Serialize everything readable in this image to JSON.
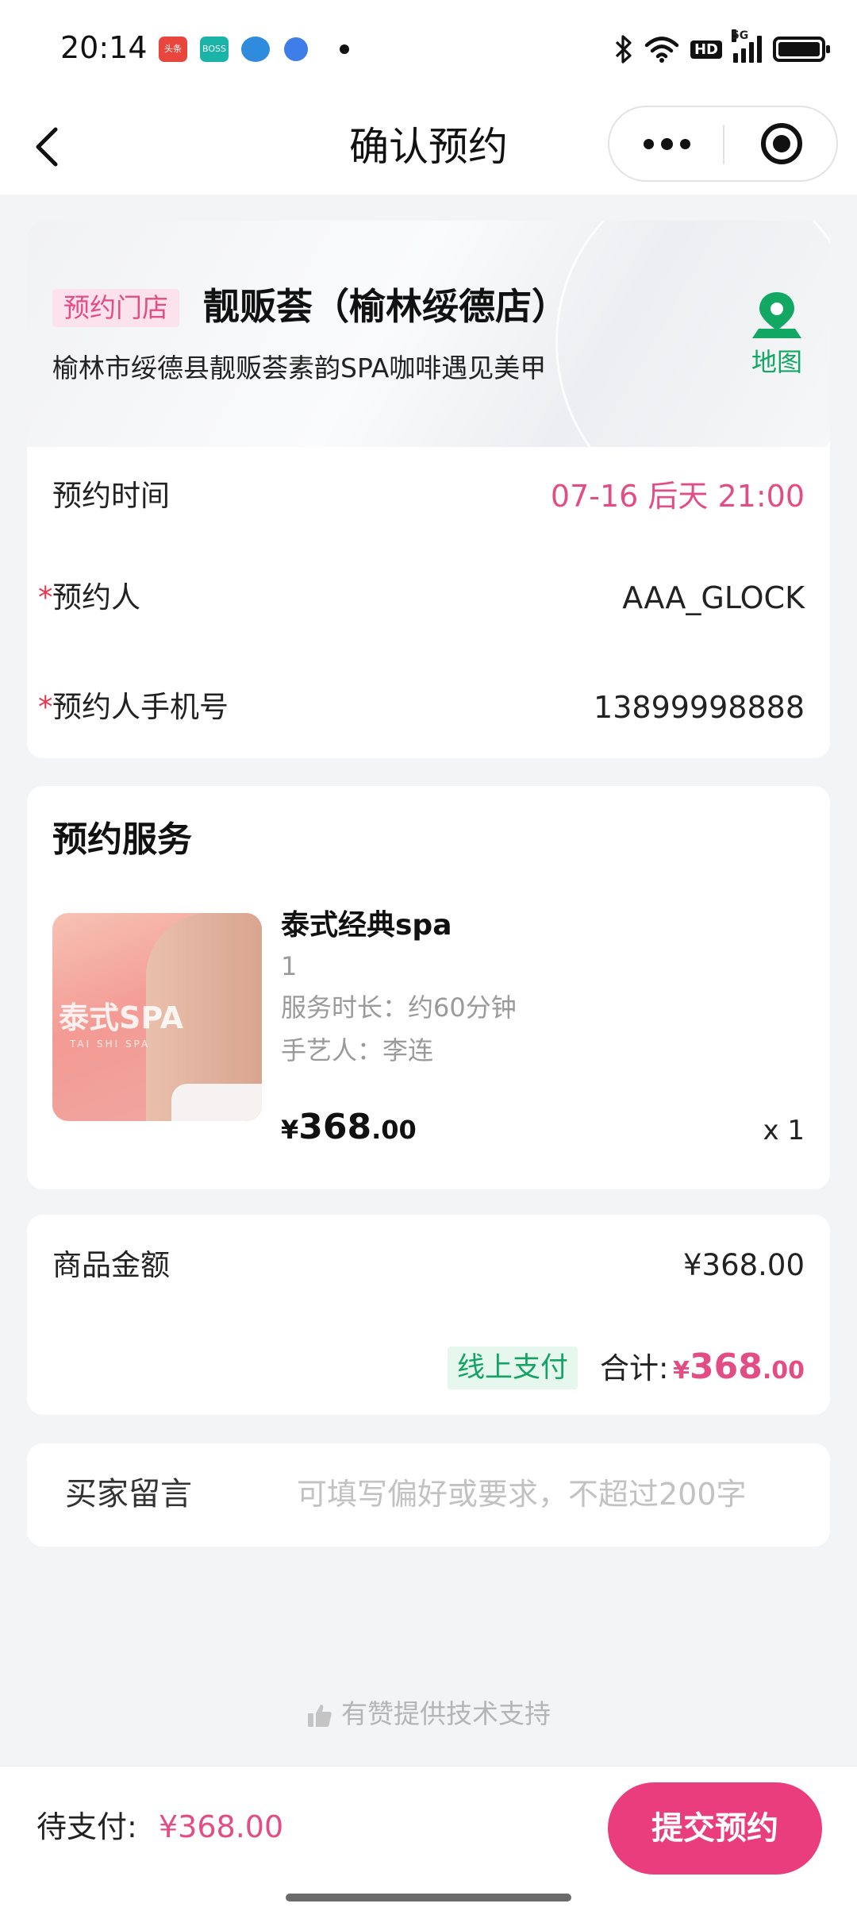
{
  "status_bar": {
    "time": "20:14",
    "apps": [
      "头条",
      "BOSS直聘",
      "",
      ""
    ],
    "hd": "HD",
    "signal": "5G"
  },
  "nav": {
    "title": "确认预约",
    "back_icon": "chevron-left-icon",
    "more_icon": "more-dots-icon",
    "close_icon": "target-circle-icon"
  },
  "store": {
    "tag": "预约门店",
    "name": "靓贩荟（榆林绥德店）",
    "address": "榆林市绥德县靓贩荟素韵SPA咖啡遇见美甲",
    "map_label": "地图",
    "map_icon": "map-pin-icon"
  },
  "booking": {
    "time_label": "预约时间",
    "time_value": "07-16 后天 21:00",
    "person_label": "预约人",
    "person_value": "AAA_GLOCK",
    "phone_label": "预约人手机号",
    "phone_value": "13899998888",
    "required_mark": "*"
  },
  "service": {
    "section_title": "预约服务",
    "thumb_text": "泰式SPA",
    "thumb_sub": "TAI SHI SPA",
    "name": "泰式经典spa",
    "spec": "1",
    "duration": "服务时长：约60分钟",
    "artisan": "手艺人：李连",
    "price_currency": "¥",
    "price_int": "368",
    "price_dec": ".00",
    "quantity": "x 1"
  },
  "amount": {
    "goods_label": "商品金额",
    "goods_value": "¥368.00",
    "pay_tag": "线上支付",
    "total_label": "合计:",
    "total_currency": "¥",
    "total_int": "368",
    "total_dec": ".00"
  },
  "note": {
    "label": "买家留言",
    "placeholder": "可填写偏好或要求，不超过200字"
  },
  "support": {
    "text": "有赞提供技术支持",
    "icon": "thumbs-up-icon"
  },
  "bottom": {
    "pending_label": "待支付:",
    "pending_value": "¥368.00",
    "submit_label": "提交预约"
  },
  "colors": {
    "accent_pink": "#e24d85",
    "button_pink": "#ea3d7e",
    "accent_green": "#14a364",
    "background": "#f3f4f6"
  }
}
